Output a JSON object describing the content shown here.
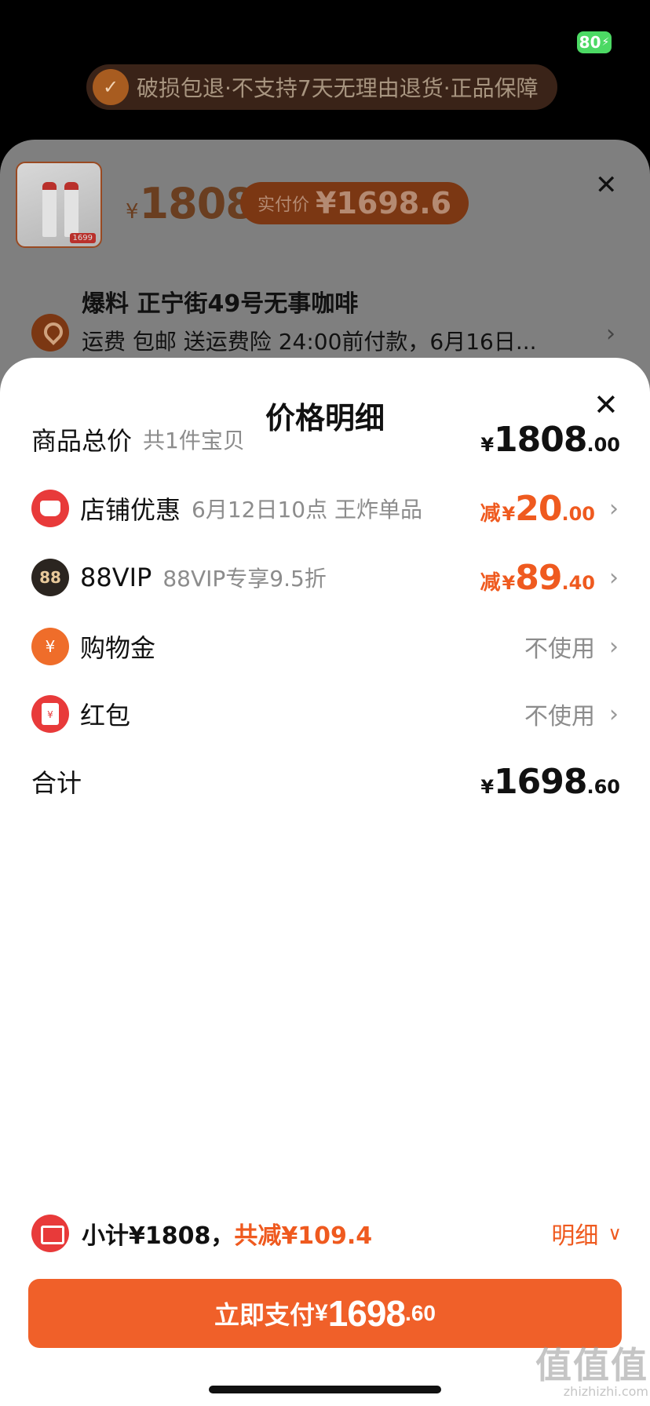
{
  "status_bar": {
    "battery": "80"
  },
  "background": {
    "guarantee_text": "破损包退·不支持7天无理由退货·正品保障",
    "product": {
      "currency": "¥",
      "price": "1808",
      "paid_label": "实付价",
      "paid_price": "¥1698.6",
      "thumb_tag": "1699"
    },
    "address": {
      "name": "爆料 正宁街49号无事咖啡",
      "shipping": "运费 包邮 送运费险 24:00前付款，6月16日..."
    }
  },
  "sheet": {
    "title": "价格明细",
    "rows": {
      "total": {
        "label": "商品总价",
        "sub": "共1件宝贝",
        "currency": "¥",
        "int": "1808",
        "dec": ".00"
      },
      "shop": {
        "label": "店铺优惠",
        "sub": "6月12日10点 王炸单品",
        "prefix": "减",
        "currency": "¥",
        "int": "20",
        "dec": ".00"
      },
      "vip": {
        "icon_text": "88",
        "label": "88VIP",
        "sub": "88VIP专享9.5折",
        "prefix": "减",
        "currency": "¥",
        "int": "89",
        "dec": ".40"
      },
      "gold": {
        "label": "购物金",
        "value": "不使用"
      },
      "redpack": {
        "label": "红包",
        "value": "不使用"
      },
      "sum": {
        "label": "合计",
        "currency": "¥",
        "int": "1698",
        "dec": ".60"
      }
    },
    "subtotal": {
      "text": "小计¥1808，",
      "saved": "共减¥109.4",
      "detail": "明细"
    },
    "pay_button": {
      "label": "立即支付",
      "currency": "¥",
      "int": "1698",
      "dec": ".60"
    }
  },
  "watermark": {
    "mark": "值值值",
    "url": "zhizhizhi.com"
  }
}
